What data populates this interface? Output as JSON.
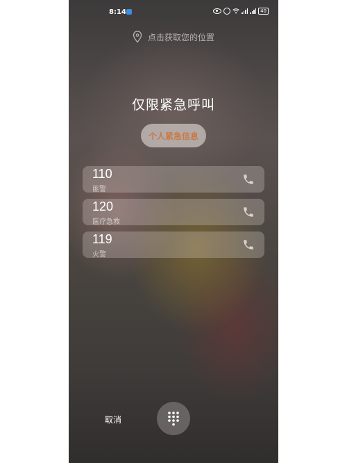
{
  "status_bar": {
    "time": "8:14",
    "battery": "40",
    "icons": [
      "shield-icon",
      "eye-icon",
      "alarm-icon",
      "wifi-icon",
      "signal-icon",
      "battery-icon"
    ]
  },
  "location": {
    "text": "点击获取您的位置",
    "icon": "location-pin-icon"
  },
  "title": "仅限紧急呼叫",
  "info_button": {
    "label": "个人紧急信息",
    "color": "#c87a4a"
  },
  "emergency_numbers": [
    {
      "number": "110",
      "label": "匪警",
      "icon": "phone-icon"
    },
    {
      "number": "120",
      "label": "医疗急救",
      "icon": "phone-icon"
    },
    {
      "number": "119",
      "label": "火警",
      "icon": "phone-icon"
    }
  ],
  "bottom": {
    "cancel_label": "取消",
    "dialpad_icon": "dialpad-icon"
  }
}
